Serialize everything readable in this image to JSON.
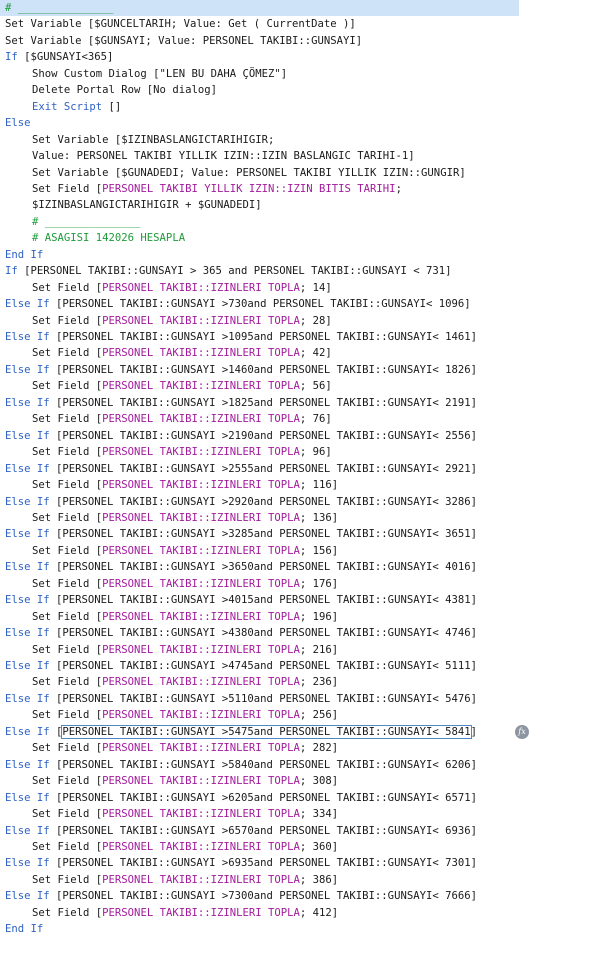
{
  "lines": [
    {
      "indent": 0,
      "parts": [
        {
          "c": "cmt",
          "t": "# _______________"
        }
      ],
      "selected": true
    },
    {
      "indent": 0,
      "parts": [
        {
          "c": "txt",
          "t": "Set Variable [$GUNCELTARIH; Value: Get ( CurrentDate )]"
        }
      ]
    },
    {
      "indent": 0,
      "parts": [
        {
          "c": "txt",
          "t": "Set Variable [$GUNSAYI; Value: PERSONEL TAKIBI::GUNSAYI]"
        }
      ]
    },
    {
      "indent": 0,
      "parts": [
        {
          "c": "kw",
          "t": "If "
        },
        {
          "c": "txt",
          "t": "[$GUNSAYI<365]"
        }
      ]
    },
    {
      "indent": 1,
      "parts": [
        {
          "c": "txt",
          "t": "Show Custom Dialog [\"LEN BU DAHA ÇÖMEZ\"]"
        }
      ]
    },
    {
      "indent": 1,
      "parts": [
        {
          "c": "txt",
          "t": "Delete Portal Row [No dialog]"
        }
      ]
    },
    {
      "indent": 1,
      "parts": [
        {
          "c": "kw",
          "t": "Exit Script "
        },
        {
          "c": "txt",
          "t": "[]"
        }
      ]
    },
    {
      "indent": 0,
      "parts": [
        {
          "c": "kw",
          "t": "Else"
        }
      ]
    },
    {
      "indent": 1,
      "parts": [
        {
          "c": "txt",
          "t": "Set Variable [$IZINBASLANGICTARIHIGIR;"
        }
      ]
    },
    {
      "indent": 1,
      "parts": [
        {
          "c": "txt",
          "t": "Value: PERSONEL TAKIBI YILLIK IZIN::IZIN BASLANGIC TARIHI-1]"
        }
      ]
    },
    {
      "indent": 1,
      "parts": [
        {
          "c": "txt",
          "t": "Set Variable [$GUNADEDI; Value: PERSONEL TAKIBI YILLIK IZIN::GUNGIR]"
        }
      ]
    },
    {
      "indent": 1,
      "parts": [
        {
          "c": "txt",
          "t": "Set Field ["
        },
        {
          "c": "fld",
          "t": "PERSONEL TAKIBI YILLIK IZIN::IZIN BITIS TARIHI"
        },
        {
          "c": "txt",
          "t": ";"
        }
      ]
    },
    {
      "indent": 1,
      "parts": [
        {
          "c": "txt",
          "t": "$IZINBASLANGICTARIHIGIR + $GUNADEDI]"
        }
      ]
    },
    {
      "indent": 1,
      "parts": [
        {
          "c": "cmt",
          "t": "# _______________"
        }
      ]
    },
    {
      "indent": 1,
      "parts": [
        {
          "c": "cmt",
          "t": "# ASAGISI 142026 HESAPLA"
        }
      ]
    },
    {
      "indent": 0,
      "parts": [
        {
          "c": "kw",
          "t": "End If"
        }
      ]
    },
    {
      "indent": 0,
      "parts": [
        {
          "c": "kw",
          "t": "If "
        },
        {
          "c": "txt",
          "t": "[PERSONEL TAKIBI::GUNSAYI > 365 and PERSONEL TAKIBI::GUNSAYI < 731]"
        }
      ]
    },
    {
      "indent": 1,
      "parts": [
        {
          "c": "txt",
          "t": "Set Field ["
        },
        {
          "c": "fld",
          "t": "PERSONEL TAKIBI::IZINLERI TOPLA"
        },
        {
          "c": "txt",
          "t": "; 14]"
        }
      ]
    },
    {
      "indent": 0,
      "parts": [
        {
          "c": "kw",
          "t": "Else If "
        },
        {
          "c": "txt",
          "t": "[PERSONEL TAKIBI::GUNSAYI >730and PERSONEL TAKIBI::GUNSAYI< 1096]"
        }
      ]
    },
    {
      "indent": 1,
      "parts": [
        {
          "c": "txt",
          "t": "Set Field ["
        },
        {
          "c": "fld",
          "t": "PERSONEL TAKIBI::IZINLERI TOPLA"
        },
        {
          "c": "txt",
          "t": "; 28]"
        }
      ]
    },
    {
      "indent": 0,
      "parts": [
        {
          "c": "kw",
          "t": "Else If "
        },
        {
          "c": "txt",
          "t": "[PERSONEL TAKIBI::GUNSAYI >1095and PERSONEL TAKIBI::GUNSAYI< 1461]"
        }
      ]
    },
    {
      "indent": 1,
      "parts": [
        {
          "c": "txt",
          "t": "Set Field ["
        },
        {
          "c": "fld",
          "t": "PERSONEL TAKIBI::IZINLERI TOPLA"
        },
        {
          "c": "txt",
          "t": "; 42]"
        }
      ]
    },
    {
      "indent": 0,
      "parts": [
        {
          "c": "kw",
          "t": "Else If "
        },
        {
          "c": "txt",
          "t": "[PERSONEL TAKIBI::GUNSAYI >1460and PERSONEL TAKIBI::GUNSAYI< 1826]"
        }
      ]
    },
    {
      "indent": 1,
      "parts": [
        {
          "c": "txt",
          "t": "Set Field ["
        },
        {
          "c": "fld",
          "t": "PERSONEL TAKIBI::IZINLERI TOPLA"
        },
        {
          "c": "txt",
          "t": "; 56]"
        }
      ]
    },
    {
      "indent": 0,
      "parts": [
        {
          "c": "kw",
          "t": "Else If "
        },
        {
          "c": "txt",
          "t": "[PERSONEL TAKIBI::GUNSAYI >1825and PERSONEL TAKIBI::GUNSAYI< 2191]"
        }
      ]
    },
    {
      "indent": 1,
      "parts": [
        {
          "c": "txt",
          "t": "Set Field ["
        },
        {
          "c": "fld",
          "t": "PERSONEL TAKIBI::IZINLERI TOPLA"
        },
        {
          "c": "txt",
          "t": "; 76]"
        }
      ]
    },
    {
      "indent": 0,
      "parts": [
        {
          "c": "kw",
          "t": "Else If "
        },
        {
          "c": "txt",
          "t": "[PERSONEL TAKIBI::GUNSAYI >2190and PERSONEL TAKIBI::GUNSAYI< 2556]"
        }
      ]
    },
    {
      "indent": 1,
      "parts": [
        {
          "c": "txt",
          "t": "Set Field ["
        },
        {
          "c": "fld",
          "t": "PERSONEL TAKIBI::IZINLERI TOPLA"
        },
        {
          "c": "txt",
          "t": "; 96]"
        }
      ]
    },
    {
      "indent": 0,
      "parts": [
        {
          "c": "kw",
          "t": "Else If "
        },
        {
          "c": "txt",
          "t": "[PERSONEL TAKIBI::GUNSAYI >2555and PERSONEL TAKIBI::GUNSAYI< 2921]"
        }
      ]
    },
    {
      "indent": 1,
      "parts": [
        {
          "c": "txt",
          "t": "Set Field ["
        },
        {
          "c": "fld",
          "t": "PERSONEL TAKIBI::IZINLERI TOPLA"
        },
        {
          "c": "txt",
          "t": "; 116]"
        }
      ]
    },
    {
      "indent": 0,
      "parts": [
        {
          "c": "kw",
          "t": "Else If "
        },
        {
          "c": "txt",
          "t": "[PERSONEL TAKIBI::GUNSAYI >2920and PERSONEL TAKIBI::GUNSAYI< 3286]"
        }
      ]
    },
    {
      "indent": 1,
      "parts": [
        {
          "c": "txt",
          "t": "Set Field ["
        },
        {
          "c": "fld",
          "t": "PERSONEL TAKIBI::IZINLERI TOPLA"
        },
        {
          "c": "txt",
          "t": "; 136]"
        }
      ]
    },
    {
      "indent": 0,
      "parts": [
        {
          "c": "kw",
          "t": "Else If "
        },
        {
          "c": "txt",
          "t": "[PERSONEL TAKIBI::GUNSAYI >3285and PERSONEL TAKIBI::GUNSAYI< 3651]"
        }
      ]
    },
    {
      "indent": 1,
      "parts": [
        {
          "c": "txt",
          "t": "Set Field ["
        },
        {
          "c": "fld",
          "t": "PERSONEL TAKIBI::IZINLERI TOPLA"
        },
        {
          "c": "txt",
          "t": "; 156]"
        }
      ]
    },
    {
      "indent": 0,
      "parts": [
        {
          "c": "kw",
          "t": "Else If "
        },
        {
          "c": "txt",
          "t": "[PERSONEL TAKIBI::GUNSAYI >3650and PERSONEL TAKIBI::GUNSAYI< 4016]"
        }
      ]
    },
    {
      "indent": 1,
      "parts": [
        {
          "c": "txt",
          "t": "Set Field ["
        },
        {
          "c": "fld",
          "t": "PERSONEL TAKIBI::IZINLERI TOPLA"
        },
        {
          "c": "txt",
          "t": "; 176]"
        }
      ]
    },
    {
      "indent": 0,
      "parts": [
        {
          "c": "kw",
          "t": "Else If "
        },
        {
          "c": "txt",
          "t": "[PERSONEL TAKIBI::GUNSAYI >4015and PERSONEL TAKIBI::GUNSAYI< 4381]"
        }
      ]
    },
    {
      "indent": 1,
      "parts": [
        {
          "c": "txt",
          "t": "Set Field ["
        },
        {
          "c": "fld",
          "t": "PERSONEL TAKIBI::IZINLERI TOPLA"
        },
        {
          "c": "txt",
          "t": "; 196]"
        }
      ]
    },
    {
      "indent": 0,
      "parts": [
        {
          "c": "kw",
          "t": "Else If "
        },
        {
          "c": "txt",
          "t": "[PERSONEL TAKIBI::GUNSAYI >4380and PERSONEL TAKIBI::GUNSAYI< 4746]"
        }
      ]
    },
    {
      "indent": 1,
      "parts": [
        {
          "c": "txt",
          "t": "Set Field ["
        },
        {
          "c": "fld",
          "t": "PERSONEL TAKIBI::IZINLERI TOPLA"
        },
        {
          "c": "txt",
          "t": "; 216]"
        }
      ]
    },
    {
      "indent": 0,
      "parts": [
        {
          "c": "kw",
          "t": "Else If "
        },
        {
          "c": "txt",
          "t": "[PERSONEL TAKIBI::GUNSAYI >4745and PERSONEL TAKIBI::GUNSAYI< 5111]"
        }
      ]
    },
    {
      "indent": 1,
      "parts": [
        {
          "c": "txt",
          "t": "Set Field ["
        },
        {
          "c": "fld",
          "t": "PERSONEL TAKIBI::IZINLERI TOPLA"
        },
        {
          "c": "txt",
          "t": "; 236]"
        }
      ]
    },
    {
      "indent": 0,
      "parts": [
        {
          "c": "kw",
          "t": "Else If "
        },
        {
          "c": "txt",
          "t": "[PERSONEL TAKIBI::GUNSAYI >5110and PERSONEL TAKIBI::GUNSAYI< 5476]"
        }
      ]
    },
    {
      "indent": 1,
      "parts": [
        {
          "c": "txt",
          "t": "Set Field ["
        },
        {
          "c": "fld",
          "t": "PERSONEL TAKIBI::IZINLERI TOPLA"
        },
        {
          "c": "txt",
          "t": "; 256]"
        }
      ]
    },
    {
      "indent": 0,
      "parts": [
        {
          "c": "kw",
          "t": "Else If "
        },
        {
          "c": "txt",
          "t": "["
        },
        {
          "c": "txt",
          "t": "PERSONEL TAKIBI::GUNSAYI >5475and PERSONEL TAKIBI::GUNSAYI< 5841",
          "box": true
        },
        {
          "c": "txt",
          "t": "]"
        }
      ],
      "fx": true
    },
    {
      "indent": 1,
      "parts": [
        {
          "c": "txt",
          "t": "Set Field ["
        },
        {
          "c": "fld",
          "t": "PERSONEL TAKIBI::IZINLERI TOPLA"
        },
        {
          "c": "txt",
          "t": "; 282]"
        }
      ]
    },
    {
      "indent": 0,
      "parts": [
        {
          "c": "kw",
          "t": "Else If "
        },
        {
          "c": "txt",
          "t": "[PERSONEL TAKIBI::GUNSAYI >5840and PERSONEL TAKIBI::GUNSAYI< 6206]"
        }
      ]
    },
    {
      "indent": 1,
      "parts": [
        {
          "c": "txt",
          "t": "Set Field ["
        },
        {
          "c": "fld",
          "t": "PERSONEL TAKIBI::IZINLERI TOPLA"
        },
        {
          "c": "txt",
          "t": "; 308]"
        }
      ]
    },
    {
      "indent": 0,
      "parts": [
        {
          "c": "kw",
          "t": "Else If "
        },
        {
          "c": "txt",
          "t": "[PERSONEL TAKIBI::GUNSAYI >6205and PERSONEL TAKIBI::GUNSAYI< 6571]"
        }
      ]
    },
    {
      "indent": 1,
      "parts": [
        {
          "c": "txt",
          "t": "Set Field ["
        },
        {
          "c": "fld",
          "t": "PERSONEL TAKIBI::IZINLERI TOPLA"
        },
        {
          "c": "txt",
          "t": "; 334]"
        }
      ]
    },
    {
      "indent": 0,
      "parts": [
        {
          "c": "kw",
          "t": "Else If "
        },
        {
          "c": "txt",
          "t": "[PERSONEL TAKIBI::GUNSAYI >6570and PERSONEL TAKIBI::GUNSAYI< 6936]"
        }
      ]
    },
    {
      "indent": 1,
      "parts": [
        {
          "c": "txt",
          "t": "Set Field ["
        },
        {
          "c": "fld",
          "t": "PERSONEL TAKIBI::IZINLERI TOPLA"
        },
        {
          "c": "txt",
          "t": "; 360]"
        }
      ]
    },
    {
      "indent": 0,
      "parts": [
        {
          "c": "kw",
          "t": "Else If "
        },
        {
          "c": "txt",
          "t": "[PERSONEL TAKIBI::GUNSAYI >6935and PERSONEL TAKIBI::GUNSAYI< 7301]"
        }
      ]
    },
    {
      "indent": 1,
      "parts": [
        {
          "c": "txt",
          "t": "Set Field ["
        },
        {
          "c": "fld",
          "t": "PERSONEL TAKIBI::IZINLERI TOPLA"
        },
        {
          "c": "txt",
          "t": "; 386]"
        }
      ]
    },
    {
      "indent": 0,
      "parts": [
        {
          "c": "kw",
          "t": "Else If "
        },
        {
          "c": "txt",
          "t": "[PERSONEL TAKIBI::GUNSAYI >7300and PERSONEL TAKIBI::GUNSAYI< 7666]"
        }
      ]
    },
    {
      "indent": 1,
      "parts": [
        {
          "c": "txt",
          "t": "Set Field ["
        },
        {
          "c": "fld",
          "t": "PERSONEL TAKIBI::IZINLERI TOPLA"
        },
        {
          "c": "txt",
          "t": "; 412]"
        }
      ]
    },
    {
      "indent": 0,
      "parts": [
        {
          "c": "kw",
          "t": "End If"
        }
      ]
    }
  ],
  "icons": {
    "fx": "fx-calculation-icon"
  },
  "colors": {
    "keyword": "#2f62c4",
    "field": "#a21b9c",
    "comment": "#1e9b3a",
    "text": "#1a1a1a",
    "selection": "#cfe3f8"
  }
}
